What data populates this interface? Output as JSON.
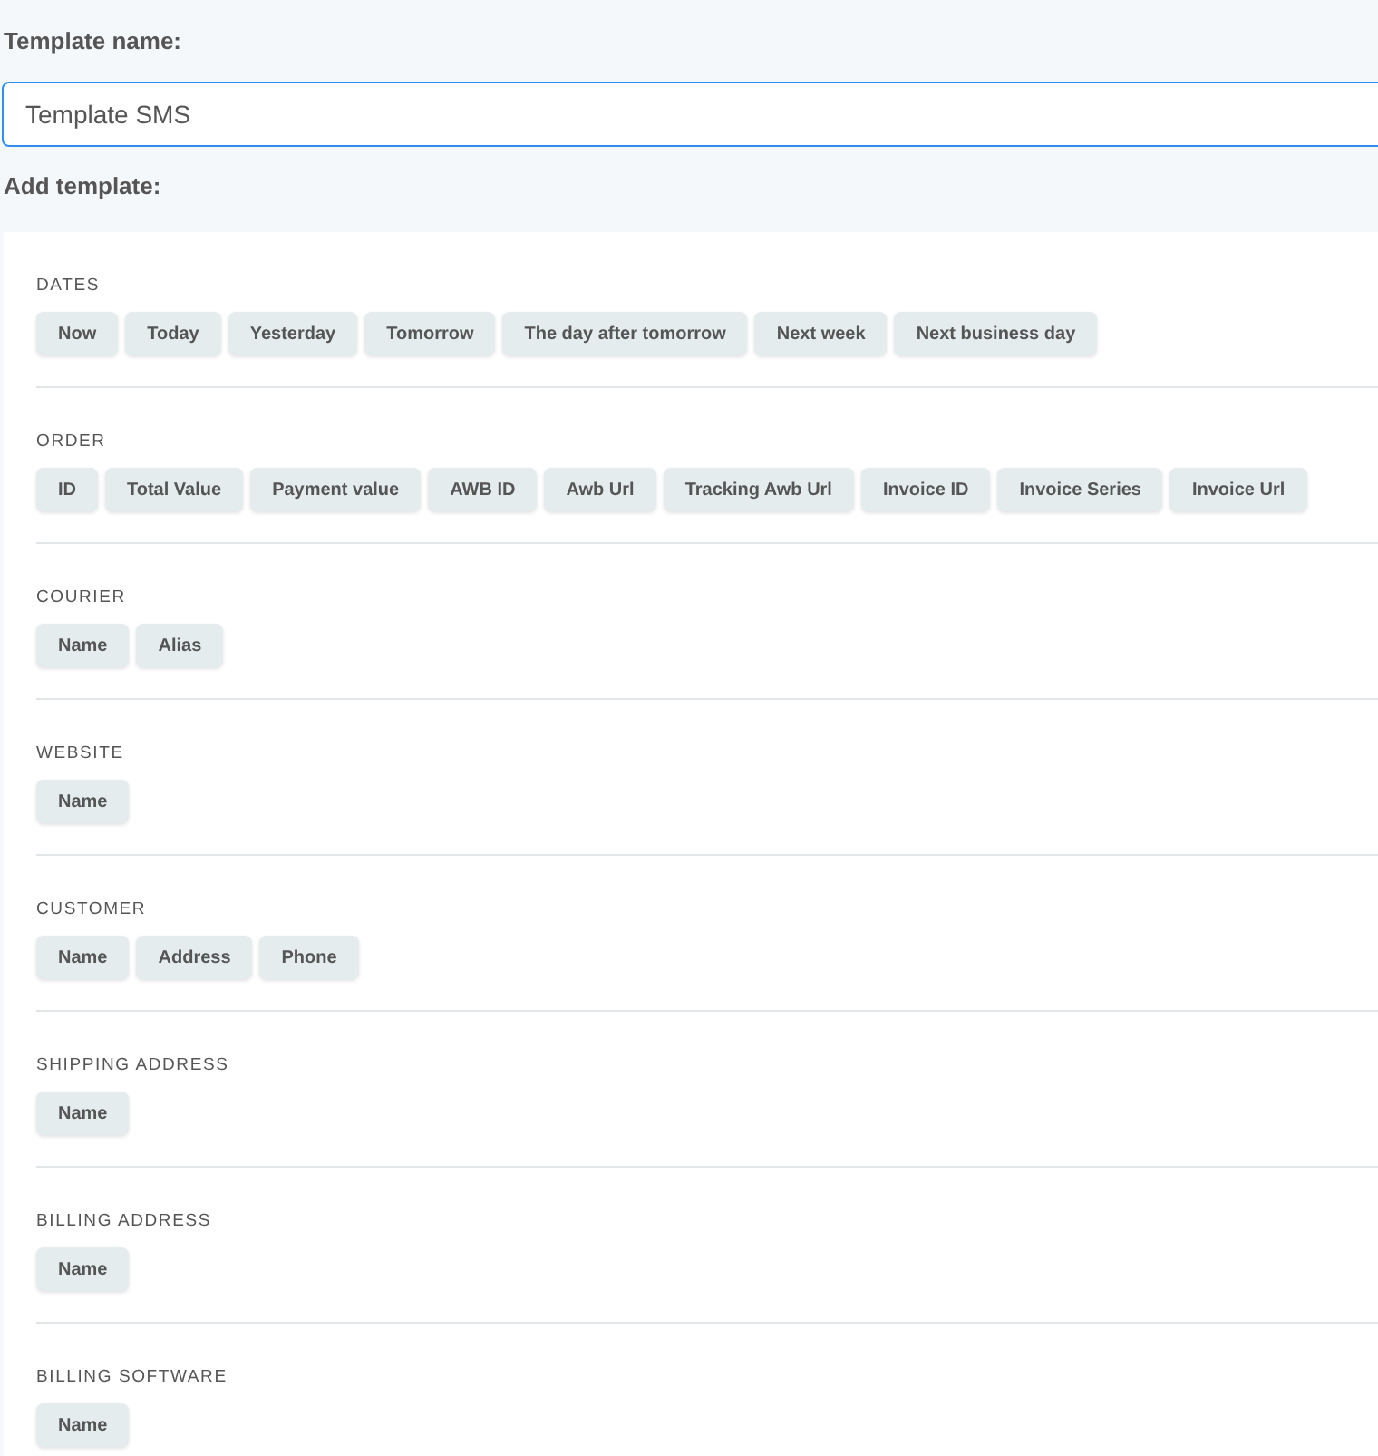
{
  "name_label": "Template name:",
  "name_field": {
    "value": "Template SMS"
  },
  "add_label": "Add template:",
  "sections": [
    {
      "title": "DATES",
      "chips": [
        "Now",
        "Today",
        "Yesterday",
        "Tomorrow",
        "The day after tomorrow",
        "Next week",
        "Next business day"
      ]
    },
    {
      "title": "ORDER",
      "chips": [
        "ID",
        "Total Value",
        "Payment value",
        "AWB ID",
        "Awb Url",
        "Tracking Awb Url",
        "Invoice ID",
        "Invoice Series",
        "Invoice Url"
      ]
    },
    {
      "title": "COURIER",
      "chips": [
        "Name",
        "Alias"
      ]
    },
    {
      "title": "WEBSITE",
      "chips": [
        "Name"
      ]
    },
    {
      "title": "CUSTOMER",
      "chips": [
        "Name",
        "Address",
        "Phone"
      ]
    },
    {
      "title": "SHIPPING ADDRESS",
      "chips": [
        "Name"
      ]
    },
    {
      "title": "BILLING ADDRESS",
      "chips": [
        "Name"
      ]
    },
    {
      "title": "BILLING SOFTWARE",
      "chips": [
        "Name"
      ]
    }
  ]
}
